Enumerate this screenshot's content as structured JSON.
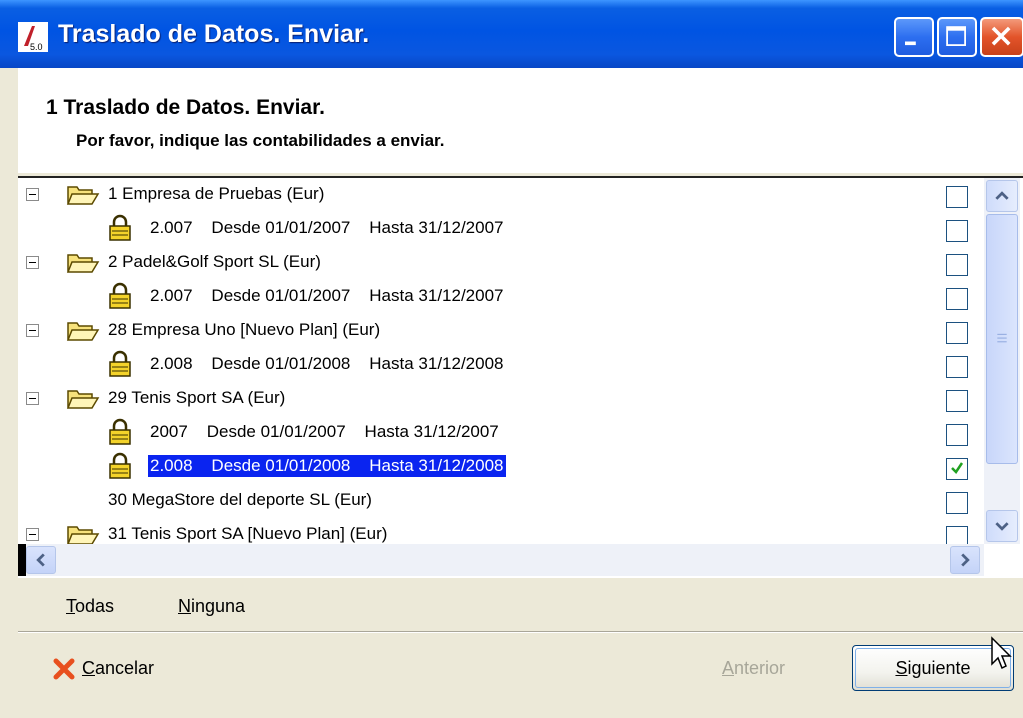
{
  "window": {
    "title": "Traslado de Datos. Enviar.",
    "icon_version": "5.0"
  },
  "header": {
    "title": "1 Traslado de Datos. Enviar.",
    "subtitle": "Por favor, indique las contabilidades a enviar."
  },
  "tree": {
    "rows": [
      {
        "type": "company",
        "label": "1 Empresa de Pruebas (Eur)",
        "checked": false,
        "expander": true,
        "icon": "folder-open-icon"
      },
      {
        "type": "year",
        "label": "2.007    Desde 01/01/2007    Hasta 31/12/2007",
        "checked": false,
        "icon": "lock-icon"
      },
      {
        "type": "company",
        "label": "2 Padel&Golf Sport SL (Eur)",
        "checked": false,
        "expander": true,
        "icon": "folder-open-icon"
      },
      {
        "type": "year",
        "label": "2.007    Desde 01/01/2007    Hasta 31/12/2007",
        "checked": false,
        "icon": "lock-icon"
      },
      {
        "type": "company",
        "label": "28 Empresa Uno [Nuevo Plan] (Eur)",
        "checked": false,
        "expander": true,
        "icon": "folder-open-icon"
      },
      {
        "type": "year",
        "label": "2.008    Desde 01/01/2008    Hasta 31/12/2008",
        "checked": false,
        "icon": "lock-icon"
      },
      {
        "type": "company",
        "label": "29 Tenis Sport SA (Eur)",
        "checked": false,
        "expander": true,
        "icon": "folder-open-icon"
      },
      {
        "type": "year",
        "label": "2007    Desde 01/01/2007    Hasta 31/12/2007",
        "checked": false,
        "icon": "lock-icon"
      },
      {
        "type": "year",
        "label": "2.008    Desde 01/01/2008    Hasta 31/12/2008",
        "checked": true,
        "selected": true,
        "icon": "lock-icon"
      },
      {
        "type": "company-leaf",
        "label": "30 MegaStore del deporte SL (Eur)",
        "checked": false
      },
      {
        "type": "company",
        "label": "31 Tenis Sport SA [Nuevo Plan] (Eur)",
        "checked": false,
        "expander": true,
        "icon": "folder-open-icon"
      }
    ]
  },
  "links": {
    "all": {
      "label": "Todas",
      "mnemonic": "T",
      "rest": "odas"
    },
    "none": {
      "label": "Ninguna",
      "mnemonic": "N",
      "rest": "inguna"
    }
  },
  "footer": {
    "cancel": {
      "label": "Cancelar",
      "mnemonic": "C",
      "rest": "ancelar"
    },
    "previous": {
      "label": "Anterior",
      "mnemonic": "A",
      "rest": "nterior",
      "enabled": false
    },
    "next": {
      "label": "Siguiente",
      "mnemonic": "S",
      "rest": "iguiente"
    }
  },
  "colors": {
    "titlebar": "#0054e3",
    "selection": "#0a24f0",
    "checkmark": "#21a121",
    "disabled_text": "#a7a699"
  }
}
